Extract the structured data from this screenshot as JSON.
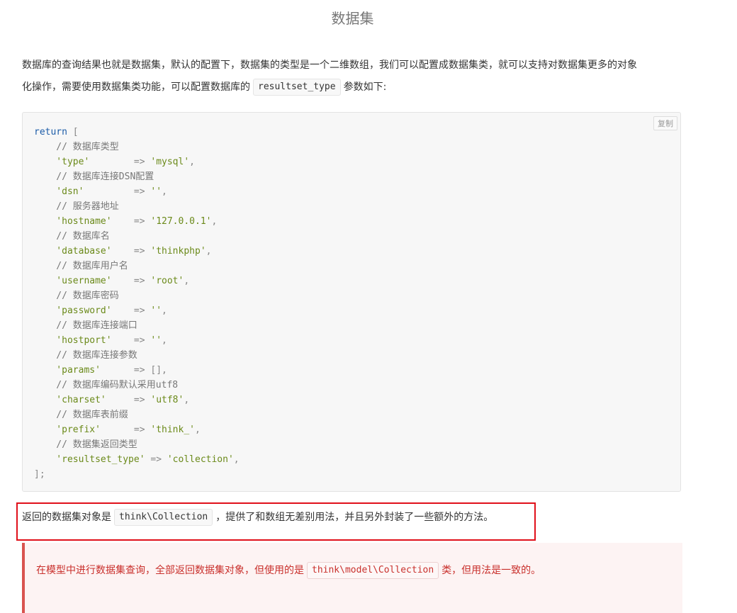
{
  "page": {
    "title": "数据集"
  },
  "intro": {
    "line1": "数据库的查询结果也就是数据集，默认的配置下，数据集的类型是一个二维数组，我们可以配置成数据集类，就可以支持对数据集更多的对象",
    "line2_before": "化操作，需要使用数据集类功能，可以配置数据库的",
    "line2_code": "resultset_type",
    "line2_after": "参数如下:"
  },
  "code": {
    "copy_label": "复制",
    "open": "return [",
    "close": "];",
    "entries": [
      {
        "comment": "// 数据库类型",
        "key": "'type'",
        "pad": "        ",
        "arrow": "=>",
        "value": "'mysql'",
        "tail": ","
      },
      {
        "comment": "// 数据库连接DSN配置",
        "key": "'dsn'",
        "pad": "         ",
        "arrow": "=>",
        "value": "''",
        "tail": ","
      },
      {
        "comment": "// 服务器地址",
        "key": "'hostname'",
        "pad": "    ",
        "arrow": "=>",
        "value": "'127.0.0.1'",
        "tail": ","
      },
      {
        "comment": "// 数据库名",
        "key": "'database'",
        "pad": "    ",
        "arrow": "=>",
        "value": "'thinkphp'",
        "tail": ","
      },
      {
        "comment": "// 数据库用户名",
        "key": "'username'",
        "pad": "    ",
        "arrow": "=>",
        "value": "'root'",
        "tail": ","
      },
      {
        "comment": "// 数据库密码",
        "key": "'password'",
        "pad": "    ",
        "arrow": "=>",
        "value": "''",
        "tail": ","
      },
      {
        "comment": "// 数据库连接端口",
        "key": "'hostport'",
        "pad": "    ",
        "arrow": "=>",
        "value": "''",
        "tail": ","
      },
      {
        "comment": "// 数据库连接参数",
        "key": "'params'",
        "pad": "      ",
        "arrow": "=>",
        "value": "[]",
        "tail": ","
      },
      {
        "comment": "// 数据库编码默认采用utf8",
        "key": "'charset'",
        "pad": "     ",
        "arrow": "=>",
        "value": "'utf8'",
        "tail": ","
      },
      {
        "comment": "// 数据库表前缀",
        "key": "'prefix'",
        "pad": "      ",
        "arrow": "=>",
        "value": "'think_'",
        "tail": ","
      },
      {
        "comment": "// 数据集返回类型",
        "key": "'resultset_type'",
        "pad": " ",
        "arrow": "=>",
        "value": "'collection'",
        "tail": ","
      }
    ]
  },
  "result": {
    "before": "返回的数据集对象是",
    "code": "think\\Collection",
    "after": "，提供了和数组无差别用法，并且另外封装了一些额外的方法。"
  },
  "warning": {
    "before": "在模型中进行数据集查询，全部返回数据集对象，但使用的是",
    "code": "think\\model\\Collection",
    "after": "类，但用法是一致的。",
    "color": "#d9534f"
  },
  "colors": {
    "highlight_box": "#e0101a",
    "keyword": "#1c5ca8",
    "string": "#6b8a1a"
  }
}
